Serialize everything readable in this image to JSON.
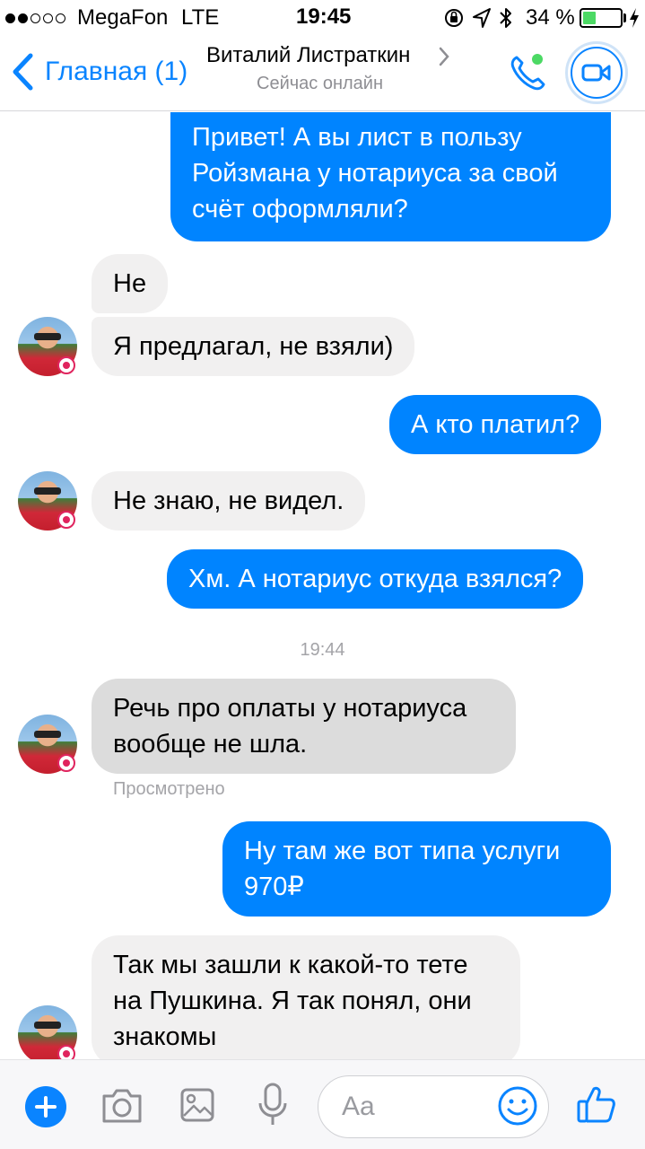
{
  "status_bar": {
    "carrier": "MegaFon",
    "network": "LTE",
    "time": "19:45",
    "battery_percent": "34 %",
    "battery_level": 0.34,
    "signal_bars_filled": 2,
    "signal_bars_total": 5
  },
  "nav": {
    "back_label": "Главная (1)",
    "contact_name": "Виталий Листраткин",
    "contact_status": "Сейчас онлайн",
    "accent_color": "#0a84ff",
    "online_color": "#4cd964"
  },
  "messages": {
    "m1": "Привет! А вы лист в пользу",
    "m1b": "Ройзмана у нотариуса за свой",
    "m1c": "счёт оформляли?",
    "m2": "Не",
    "m3": "Я предлагал, не взяли)",
    "m4": "А кто платил?",
    "m5": "Не знаю, не видел.",
    "m6": "Хм. А нотариус откуда взялся?",
    "time_divider": "19:44",
    "m7a": "Речь про оплаты у нотариуса",
    "m7b": "вообще не шла.",
    "seen_label": "Просмотрено",
    "m8a": "Ну там же вот типа услуги",
    "m8b": "970₽",
    "m9a": "Так мы зашли к какой-то тете",
    "m9b": "на Пушкина. Я так понял, они",
    "m9c": "знакомы",
    "outgoing_color": "#0084ff",
    "incoming_color": "#f1f0f0"
  },
  "composer": {
    "placeholder": "Aa",
    "icons": [
      "plus-icon",
      "camera-icon",
      "gallery-icon",
      "microphone-icon",
      "emoji-icon",
      "thumbs-up-icon"
    ]
  }
}
